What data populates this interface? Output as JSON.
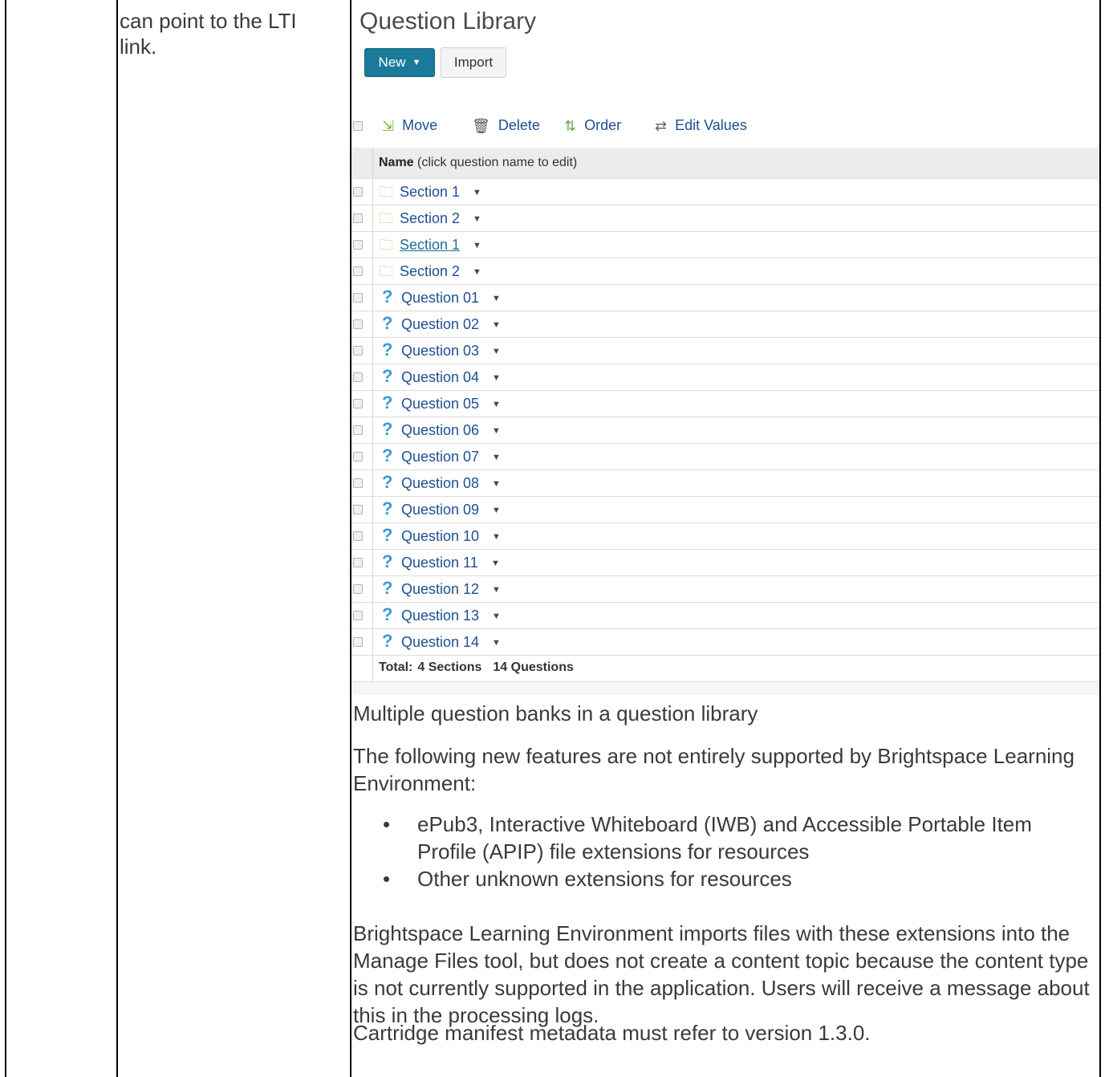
{
  "left_cell": {
    "text": "can point to the LTI link."
  },
  "question_library": {
    "title": "Question Library",
    "new_button": "New",
    "import_button": "Import",
    "toolbar": {
      "move": "Move",
      "delete": "Delete",
      "order": "Order",
      "edit_values": "Edit Values"
    },
    "header": {
      "bold": "Name",
      "rest": " (click question name to edit)"
    },
    "sections": [
      {
        "label": "Section 1",
        "link": false
      },
      {
        "label": "Section 2",
        "link": false
      },
      {
        "label": "Section 1",
        "link": true
      },
      {
        "label": "Section 2",
        "link": false
      }
    ],
    "questions": [
      "Question 01",
      "Question 02",
      "Question 03",
      "Question 04",
      "Question 05",
      "Question 06",
      "Question 07",
      "Question 08",
      "Question 09",
      "Question 10",
      "Question 11",
      "Question 12",
      "Question 13",
      "Question 14"
    ],
    "total": {
      "label": "Total:",
      "sections": "4 Sections",
      "questions": "14 Questions"
    }
  },
  "caption": "Multiple question banks in a question library",
  "paragraph1": "The following new features are not entirely supported by Brightspace Learning Environment:",
  "bullets": [
    "ePub3, Interactive Whiteboard (IWB) and Accessible Portable Item Profile (APIP) file extensions for resources",
    "Other unknown extensions for resources"
  ],
  "paragraph2": "Brightspace Learning Environment imports files with these extensions into the Manage Files tool, but does not create a content topic because the content type is not currently supported in the application. Users will receive a message about this in the processing logs.",
  "paragraph3": "Cartridge manifest metadata must refer to version 1.3.0."
}
